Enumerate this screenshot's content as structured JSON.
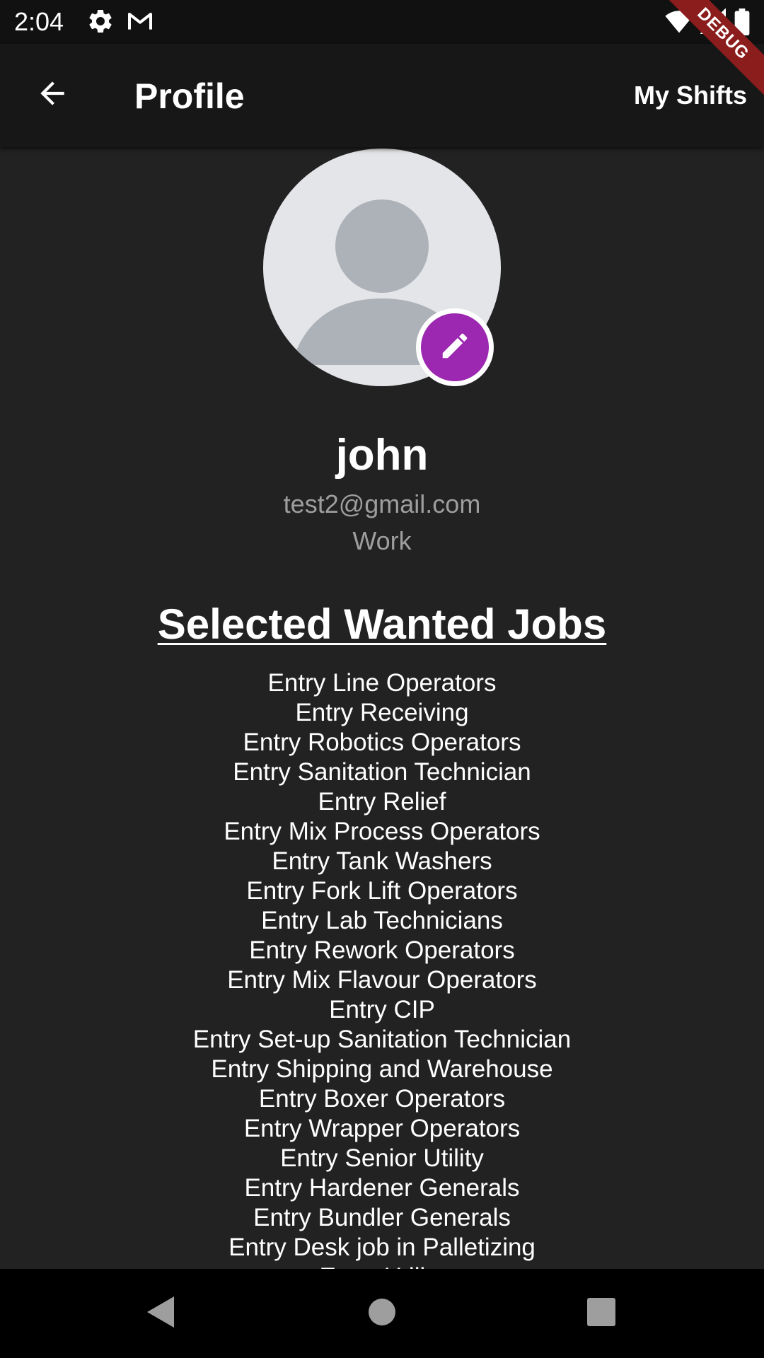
{
  "status_bar": {
    "time": "2:04",
    "icons": [
      "settings-icon",
      "gmail-icon",
      "wifi-icon",
      "signal-icon",
      "battery-icon"
    ]
  },
  "debug_banner": "DEBUG",
  "app_bar": {
    "title": "Profile",
    "action_label": "My Shifts"
  },
  "profile": {
    "name": "john",
    "email": "test2@gmail.com",
    "role": "Work"
  },
  "jobs": {
    "heading": "Selected Wanted Jobs",
    "items": [
      "Entry Line Operators",
      "Entry Receiving",
      "Entry Robotics Operators",
      "Entry Sanitation Technician",
      "Entry Relief",
      "Entry Mix Process Operators",
      "Entry Tank Washers",
      "Entry Fork Lift Operators",
      "Entry Lab Technicians",
      "Entry Rework Operators",
      "Entry Mix Flavour Operators",
      "Entry CIP",
      "Entry Set-up Sanitation Technician",
      "Entry Shipping and Warehouse",
      "Entry Boxer Operators",
      "Entry Wrapper Operators",
      "Entry Senior Utility",
      "Entry Hardener Generals",
      "Entry Bundler Generals",
      "Entry Desk job in Palletizing",
      "Entry Utility"
    ]
  },
  "colors": {
    "background": "#222222",
    "app_bar": "#171717",
    "accent": "#9c27b0",
    "secondary_text": "#9e9e9e",
    "debug_ribbon": "#8b1d1d"
  }
}
